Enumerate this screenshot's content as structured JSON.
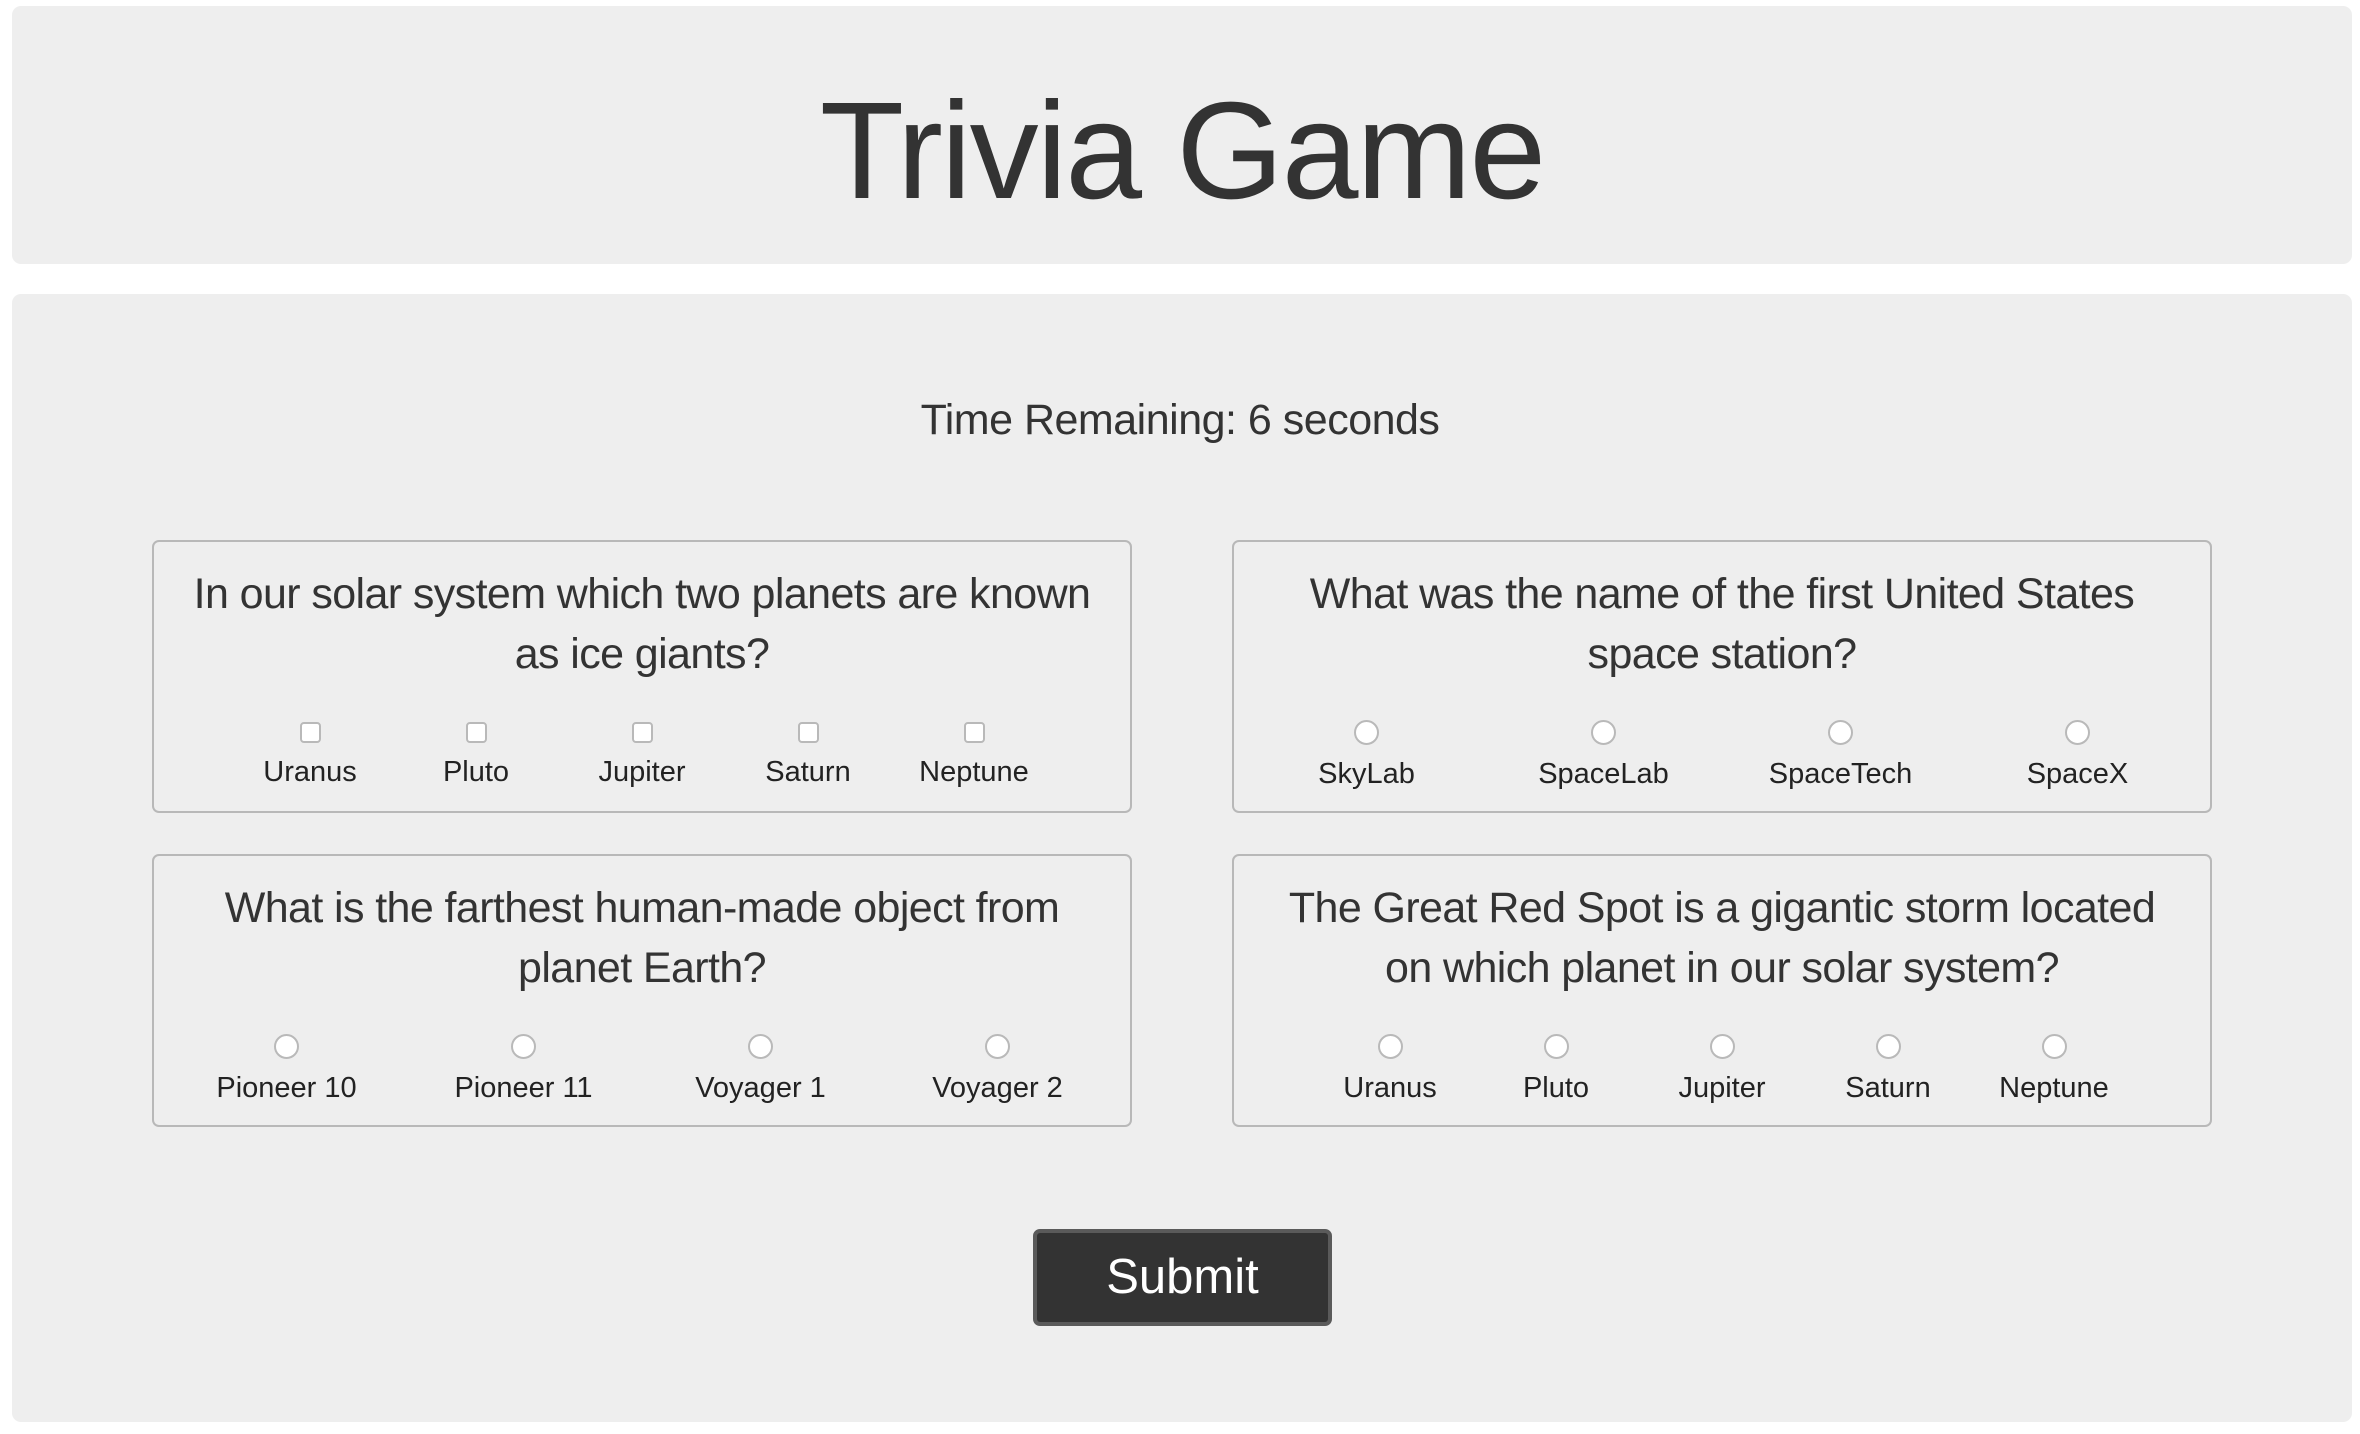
{
  "header": {
    "title": "Trivia Game"
  },
  "timer": {
    "text": "Time Remaining: 6 seconds",
    "seconds_remaining": 6
  },
  "questions": [
    {
      "text": "In our solar system which two planets are known as ice giants?",
      "input_type": "checkbox",
      "options": [
        "Uranus",
        "Pluto",
        "Jupiter",
        "Saturn",
        "Neptune"
      ]
    },
    {
      "text": "What was the name of the first United States space station?",
      "input_type": "radio",
      "options": [
        "SkyLab",
        "SpaceLab",
        "SpaceTech",
        "SpaceX"
      ]
    },
    {
      "text": "What is the farthest human-made object from planet Earth?",
      "input_type": "radio",
      "options": [
        "Pioneer 10",
        "Pioneer 11",
        "Voyager 1",
        "Voyager 2"
      ]
    },
    {
      "text": "The Great Red Spot is a gigantic storm located on which planet in our solar system?",
      "input_type": "radio",
      "options": [
        "Uranus",
        "Pluto",
        "Jupiter",
        "Saturn",
        "Neptune"
      ]
    }
  ],
  "submit": {
    "label": "Submit"
  },
  "colors": {
    "panel_background": "#eeeeee",
    "text": "#333333",
    "button_background": "#333333",
    "button_text": "#ffffff",
    "card_border": "#b8b8b8"
  }
}
